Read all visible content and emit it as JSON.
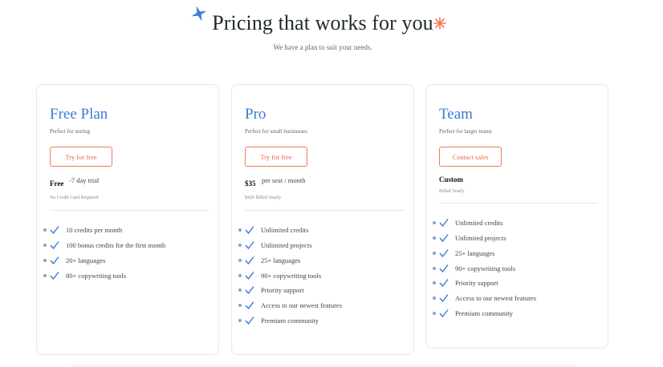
{
  "header": {
    "title": "Pricing that works for you",
    "subtitle": "We have a plan to suit your needs."
  },
  "colors": {
    "accent_blue": "#3a7bd5",
    "accent_orange": "#e8674a",
    "check_blue": "#3a7bd5"
  },
  "plans": [
    {
      "name": "Free Plan",
      "description": "Perfect for testing",
      "cta": "Try for free",
      "price": "Free",
      "price_note": "-7 day trial",
      "fine_print": "No Credit Card Required",
      "features": [
        "10 credits per month",
        "100 bonus credits for the first month",
        "20+ languages",
        "80+ copywriting tools"
      ]
    },
    {
      "name": "Pro",
      "description": "Perfect for small businesses",
      "cta": "Try for free",
      "price": "$35",
      "price_note": "per seat / month",
      "fine_print": "$420 Billed Yearly",
      "features": [
        "Unlimited credits",
        "Unlimited projects",
        "25+ languages",
        "90+ copywriting tools",
        "Priority support",
        "Access to our newest features",
        "Premium community"
      ]
    },
    {
      "name": "Team",
      "description": "Perfect for larger teams",
      "cta": "Contact sales",
      "price": "Custom",
      "fine_print": "Billed Yearly",
      "features": [
        "Unlimited credits",
        "Unlimited projects",
        "25+ languages",
        "90+ copywriting tools",
        "Priority support",
        "Access to our newest features",
        "Premium community"
      ]
    }
  ]
}
